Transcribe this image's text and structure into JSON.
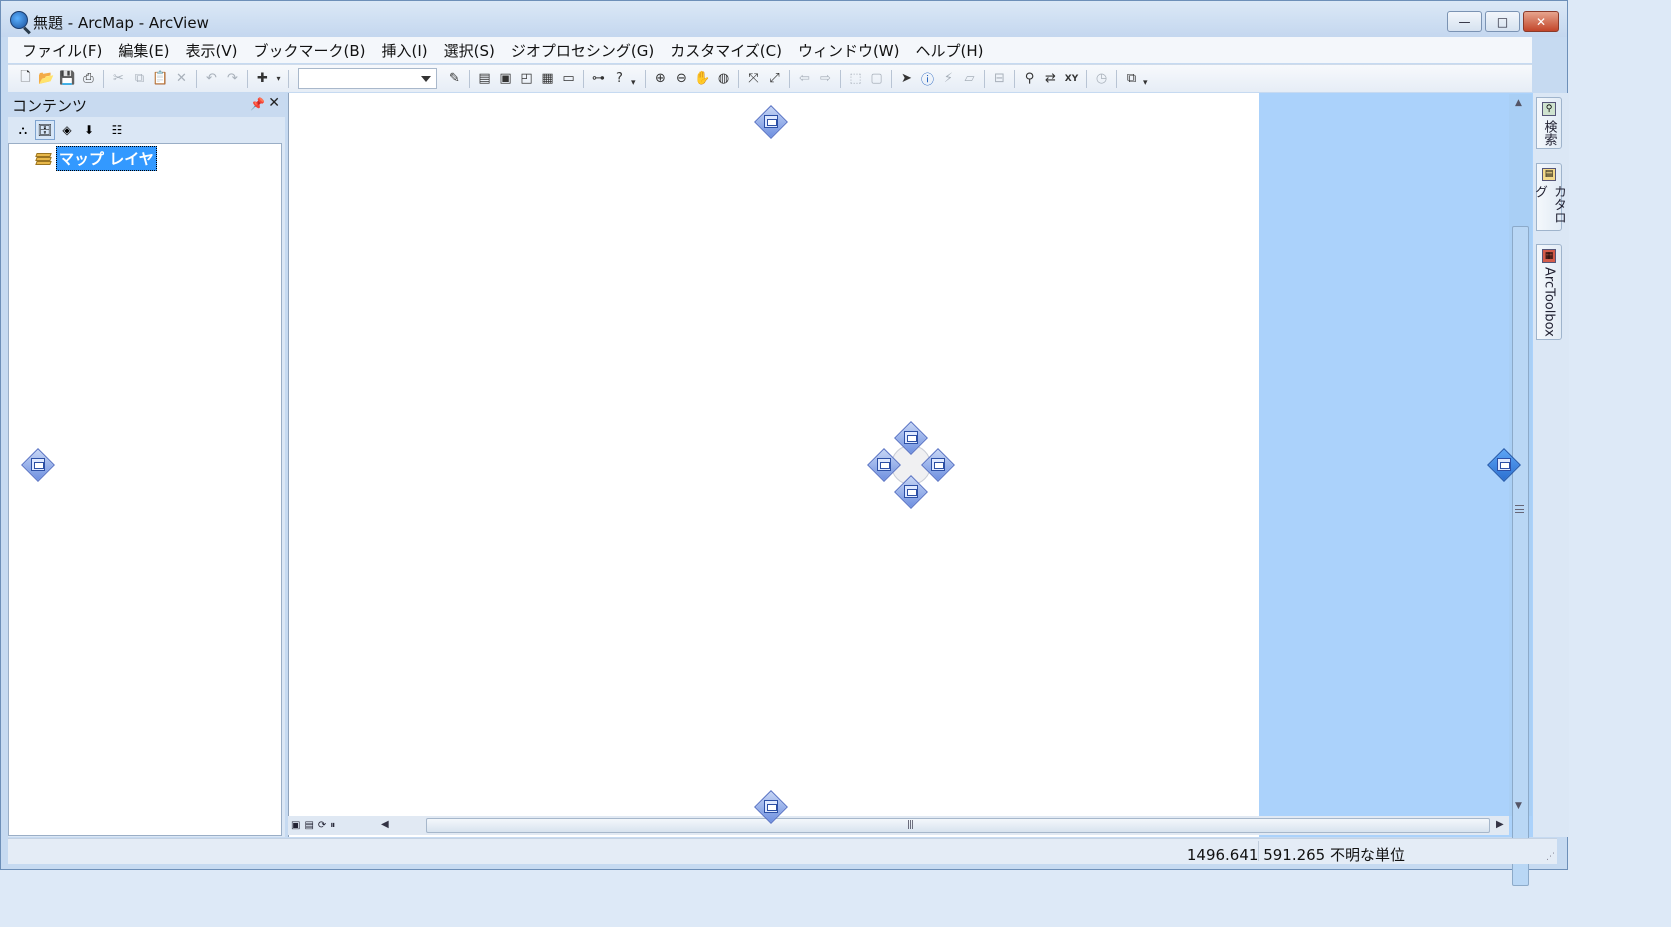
{
  "window": {
    "title": "無題 - ArcMap - ArcView",
    "controls": {
      "minimize": "—",
      "maximize": "□",
      "close": "✕"
    }
  },
  "menubar": {
    "items": [
      "ファイル(F)",
      "編集(E)",
      "表示(V)",
      "ブックマーク(B)",
      "挿入(I)",
      "選択(S)",
      "ジオプロセシング(G)",
      "カスタマイズ(C)",
      "ウィンドウ(W)",
      "ヘルプ(H)"
    ]
  },
  "toolbar": {
    "scale_value": "",
    "icons": [
      "new-document-icon",
      "open-icon",
      "save-icon",
      "print-icon",
      "cut-icon",
      "copy-icon",
      "paste-icon",
      "delete-icon",
      "undo-icon",
      "redo-icon",
      "add-data-icon",
      "editor-icon",
      "table-icon",
      "catalog-icon",
      "toolbox-icon",
      "python-icon",
      "model-builder-icon",
      "whats-this-icon",
      "zoom-in-icon",
      "zoom-out-icon",
      "pan-icon",
      "full-extent-icon",
      "fixed-zoom-in-icon",
      "fixed-zoom-out-icon",
      "back-icon",
      "forward-icon",
      "select-features-icon",
      "clear-selection-icon",
      "select-elements-icon",
      "identify-icon",
      "hyperlink-icon",
      "html-popup-icon",
      "measure-icon",
      "find-icon",
      "find-route-icon",
      "go-to-xy-icon",
      "time-slider-icon",
      "create-viewer-icon"
    ]
  },
  "toc": {
    "title": "コンテンツ",
    "pin": "ꟷ",
    "close": "✕",
    "tools": [
      "list-by-drawing-order-icon",
      "list-by-source-icon",
      "list-by-visibility-icon",
      "list-by-selection-icon",
      "options-icon"
    ],
    "tree": {
      "root_label": "マップ レイヤ"
    }
  },
  "right_dock": {
    "tabs": [
      {
        "label": "検索",
        "icon": "search-window-icon"
      },
      {
        "label": "カタログ",
        "icon": "catalog-window-icon"
      },
      {
        "label": "ArcToolbox",
        "icon": "arctoolbox-icon"
      }
    ]
  },
  "status": {
    "coordinates": "1496.641  591.265 不明な単位"
  },
  "colors": {
    "dock_preview": "#abd2fb",
    "selection": "#3399ff",
    "frame": "#c6daf1"
  }
}
